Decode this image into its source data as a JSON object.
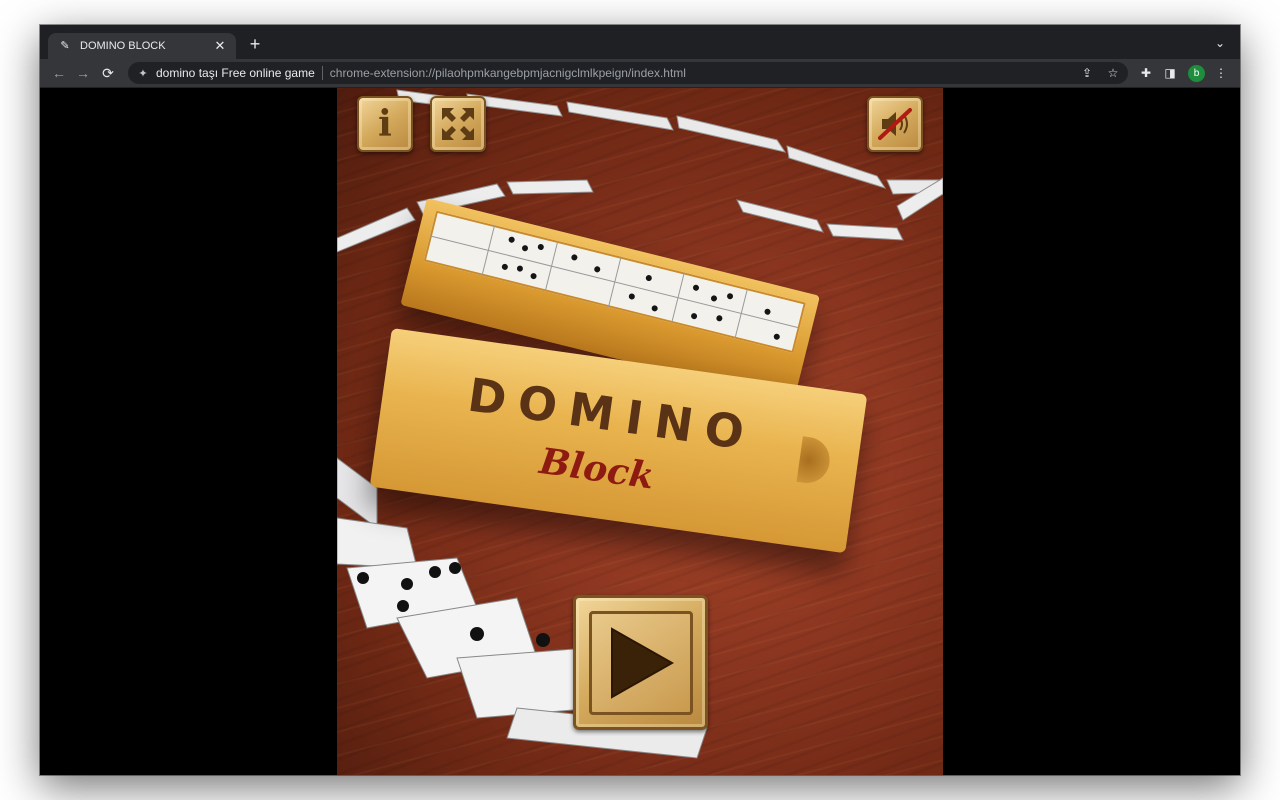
{
  "browser": {
    "tab": {
      "title": "DOMINO BLOCK",
      "favicon": "pen-icon"
    },
    "omnibox": {
      "site_name": "domino taşı Free online game",
      "url": "chrome-extension://pilaohpmkangebpmjacnigclmlkpeign/index.html"
    },
    "profile_initial": "b",
    "colors": {
      "frame": "#1f2023",
      "toolbar": "#35363a",
      "omnibox": "#202124",
      "avatar": "#1e8e3e"
    }
  },
  "game": {
    "title": "DOMINO",
    "subtitle": "Block",
    "buttons": {
      "info": {
        "icon": "info-icon",
        "label": "i"
      },
      "fullscreen": {
        "icon": "fullscreen-icon"
      },
      "sound": {
        "icon": "sound-muted-icon",
        "state": "muted"
      },
      "play": {
        "icon": "play-icon"
      }
    },
    "colors": {
      "table": "#8c3620",
      "wood_light": "#f2d69a",
      "wood_dark": "#7a5320",
      "title": "#5a3215",
      "subtitle": "#8e1b12"
    }
  }
}
